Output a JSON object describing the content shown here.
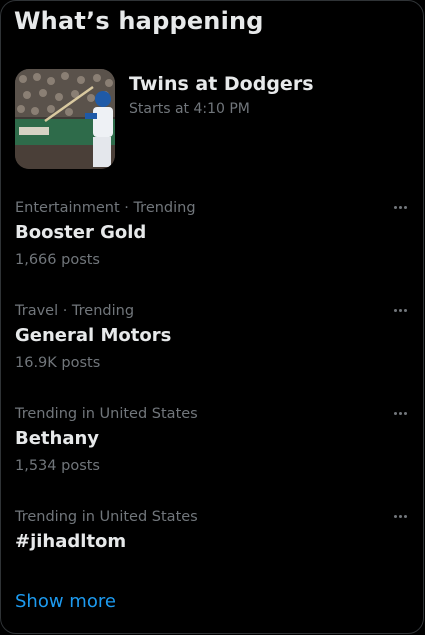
{
  "header": {
    "title": "What’s happening"
  },
  "event": {
    "title": "Twins at Dodgers",
    "subtitle": "Starts at 4:10 PM"
  },
  "trends": [
    {
      "context": "Entertainment · Trending",
      "name": "Booster Gold",
      "count": "1,666 posts"
    },
    {
      "context": "Travel · Trending",
      "name": "General Motors",
      "count": "16.9K posts"
    },
    {
      "context": "Trending in United States",
      "name": "Bethany",
      "count": "1,534 posts"
    },
    {
      "context": "Trending in United States",
      "name": "#jihadltom",
      "count": ""
    }
  ],
  "footer": {
    "show_more": "Show more"
  },
  "icons": {
    "more": "more-horizontal-icon"
  },
  "colors": {
    "background": "#000000",
    "text": "#e7e9ea",
    "secondary": "#71767b",
    "accent": "#1d9bf0",
    "border": "#2f3336"
  }
}
